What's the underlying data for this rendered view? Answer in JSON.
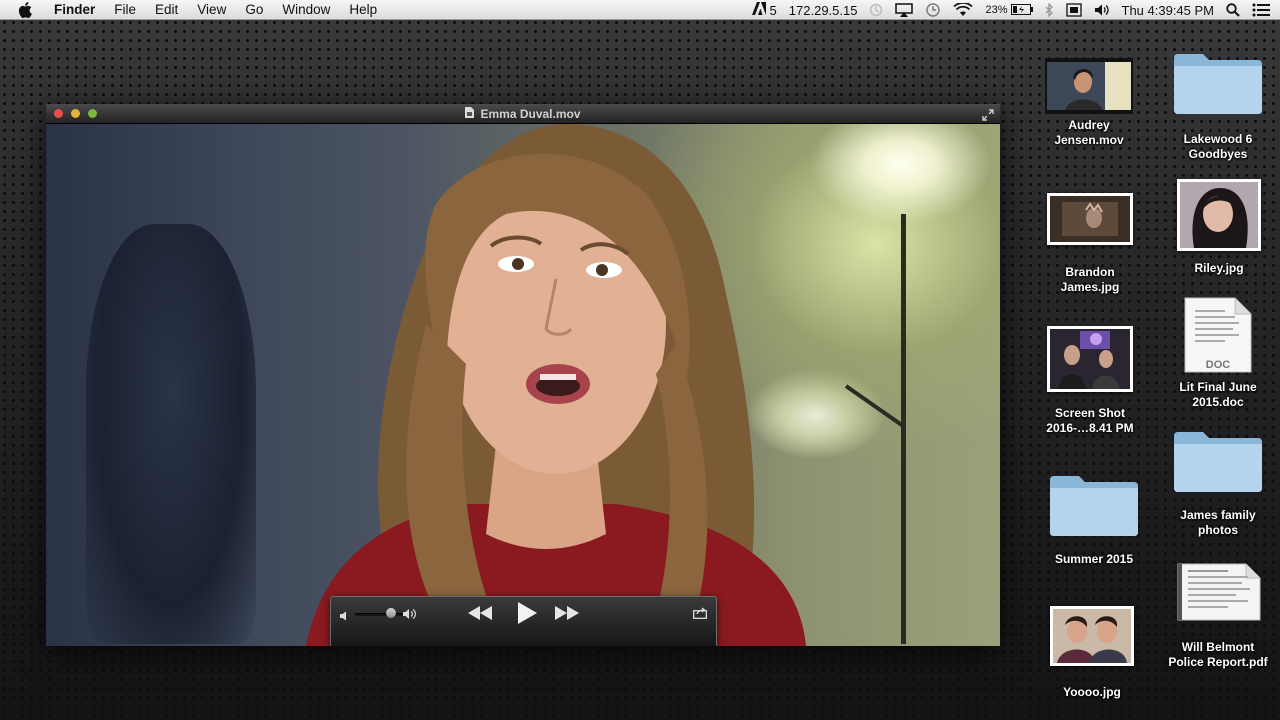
{
  "menubar": {
    "app_name": "Finder",
    "menus": [
      "File",
      "Edit",
      "View",
      "Go",
      "Window",
      "Help"
    ],
    "status": {
      "adobe_badge": "5",
      "ip_address": "172.29.5.15",
      "battery_percent": "23%",
      "clock": "Thu 4:39:45 PM"
    }
  },
  "player": {
    "title": "Emma Duval.mov",
    "volume_level": 0.75
  },
  "desktop": {
    "icons": [
      {
        "label": "Audrey\nJensen.mov",
        "kind": "video"
      },
      {
        "label": "Lakewood 6\nGoodbyes",
        "kind": "folder"
      },
      {
        "label": "Brandon\nJames.jpg",
        "kind": "image"
      },
      {
        "label": "Riley.jpg",
        "kind": "image"
      },
      {
        "label": "Screen Shot\n2016-…8.41 PM",
        "kind": "image"
      },
      {
        "label": "Lit Final June\n2015.doc",
        "kind": "document"
      },
      {
        "label": "Summer 2015",
        "kind": "folder"
      },
      {
        "label": "James family\nphotos",
        "kind": "folder"
      },
      {
        "label": "Yoooo.jpg",
        "kind": "image"
      },
      {
        "label": "Will Belmont\nPolice Report.pdf",
        "kind": "pdf"
      }
    ],
    "doc_badge": "DOC"
  },
  "colors": {
    "menubar_bg": "#e8e8e8",
    "folder_blue": "#a9cde6",
    "close": "#e94e4a",
    "minimize": "#e2b43a",
    "zoom": "#79b73f"
  }
}
